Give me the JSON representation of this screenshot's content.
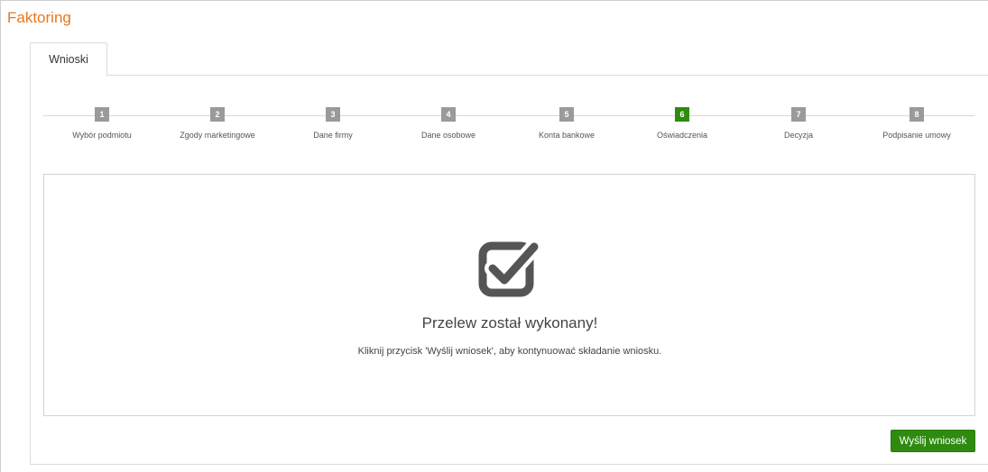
{
  "page": {
    "title": "Faktoring"
  },
  "tabs": [
    {
      "label": "Wnioski"
    }
  ],
  "steps": [
    {
      "number": "1",
      "label": "Wybór podmiotu",
      "active": false
    },
    {
      "number": "2",
      "label": "Zgody marketingowe",
      "active": false
    },
    {
      "number": "3",
      "label": "Dane firmy",
      "active": false
    },
    {
      "number": "4",
      "label": "Dane osobowe",
      "active": false
    },
    {
      "number": "5",
      "label": "Konta bankowe",
      "active": false
    },
    {
      "number": "6",
      "label": "Oświadczenia",
      "active": true
    },
    {
      "number": "7",
      "label": "Decyzja",
      "active": false
    },
    {
      "number": "8",
      "label": "Podpisanie umowy",
      "active": false
    }
  ],
  "message": {
    "icon": "checkbox-checked-icon",
    "title": "Przelew został wykonany!",
    "subtitle": "Kliknij przycisk 'Wyślij wniosek', aby kontynuować składanie wniosku."
  },
  "actions": {
    "send_label": "Wyślij wniosek"
  },
  "colors": {
    "accent": "#e87722",
    "active_step": "#2e8b0f",
    "inactive_step": "#9a9a9a",
    "button": "#2e8b0f",
    "icon": "#555555"
  }
}
